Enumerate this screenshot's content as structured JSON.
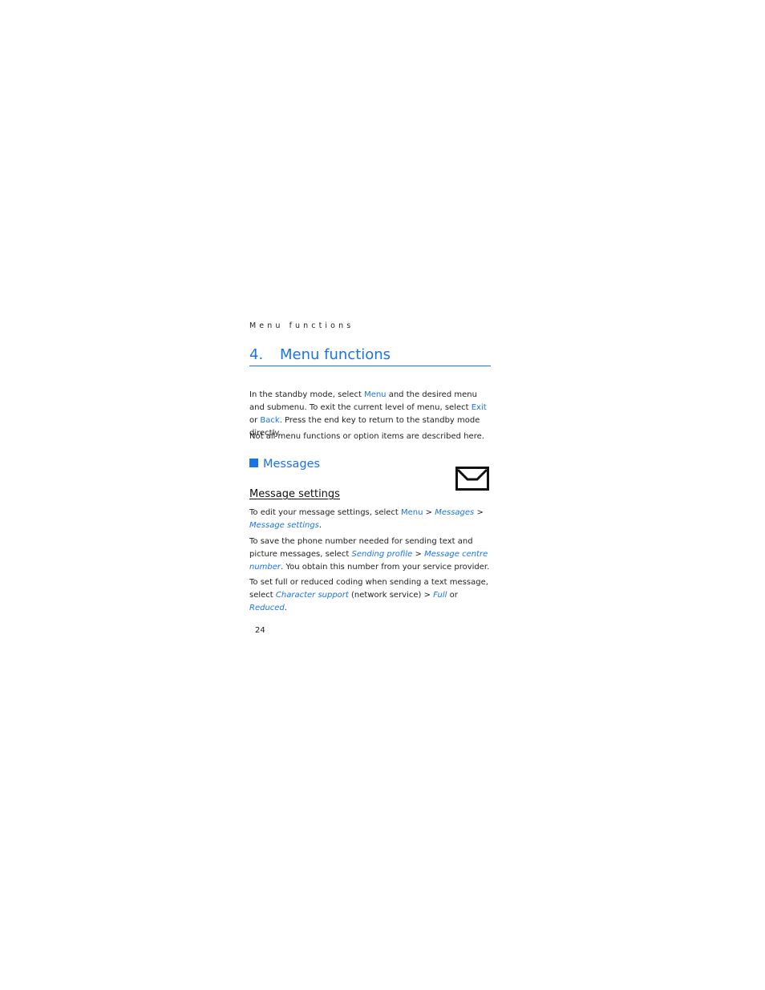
{
  "running_head": "Menu functions",
  "chapter": {
    "number": "4.",
    "title": "Menu functions"
  },
  "intro": {
    "p1": {
      "t1": "In the standby mode, select ",
      "k1": "Menu",
      "t2": " and the desired menu and submenu. To exit the current level of menu, select ",
      "k2": "Exit",
      "t3": " or ",
      "k3": "Back",
      "t4": ". Press the end key to return to the standby mode directly."
    },
    "p2": "Not all menu functions or option items are described here."
  },
  "section": {
    "title": "Messages",
    "icon": "envelope-icon",
    "subsection": {
      "title": "Message settings",
      "p1": {
        "t1": "To edit your message settings, select ",
        "k1": "Menu",
        "t2": " > ",
        "k2": "Messages",
        "t3": " > ",
        "k3": "Message settings",
        "t4": "."
      },
      "p2": {
        "t1": "To save the phone number needed for sending text and picture messages, select ",
        "k1": "Sending profile",
        "t2": " > ",
        "k2": "Message centre number",
        "t3": ". You obtain this number from your service provider."
      },
      "p3": {
        "t1": "To set full or reduced coding when sending a text message, select ",
        "k1": "Character support",
        "t2": " (network service) > ",
        "k2": "Full",
        "t3": " or ",
        "k3": "Reduced",
        "t4": "."
      }
    }
  },
  "page_number": "24",
  "colors": {
    "accent": "#1a73e8",
    "text": "#222222"
  }
}
